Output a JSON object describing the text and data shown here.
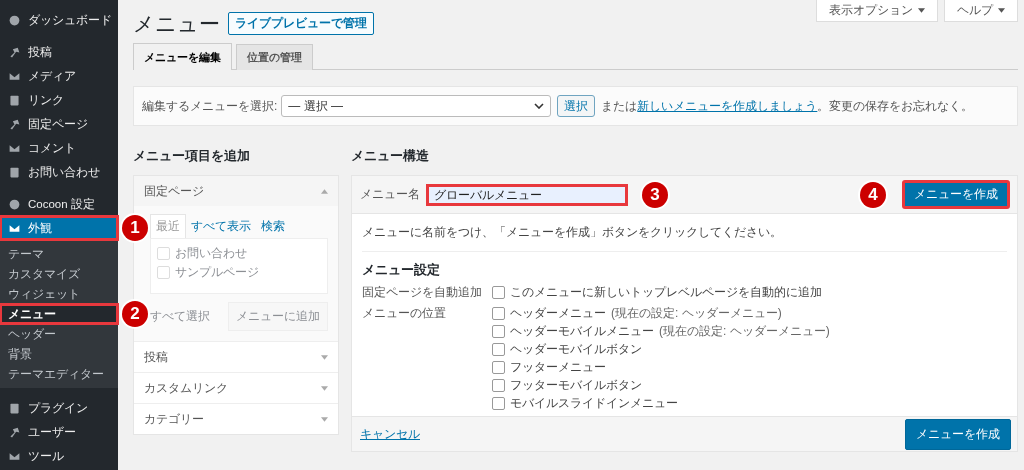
{
  "sidebar": {
    "items": [
      {
        "label": "ダッシュボード",
        "selected": false,
        "highlighted": false
      },
      {
        "label": "投稿",
        "selected": false,
        "highlighted": false
      },
      {
        "label": "メディア",
        "selected": false,
        "highlighted": false
      },
      {
        "label": "リンク",
        "selected": false,
        "highlighted": false
      },
      {
        "label": "固定ページ",
        "selected": false,
        "highlighted": false
      },
      {
        "label": "コメント",
        "selected": false,
        "highlighted": false
      },
      {
        "label": "お問い合わせ",
        "selected": false,
        "highlighted": false
      },
      {
        "label": "Cocoon 設定",
        "selected": false,
        "highlighted": false
      },
      {
        "label": "外観",
        "selected": true,
        "highlighted": true,
        "marker": "1",
        "children": [
          {
            "label": "テーマ",
            "selected": false,
            "highlighted": false
          },
          {
            "label": "カスタマイズ",
            "selected": false,
            "highlighted": false
          },
          {
            "label": "ウィジェット",
            "selected": false,
            "highlighted": false
          },
          {
            "label": "メニュー",
            "selected": true,
            "highlighted": true,
            "marker": "2"
          },
          {
            "label": "ヘッダー",
            "selected": false,
            "highlighted": false
          },
          {
            "label": "背景",
            "selected": false,
            "highlighted": false
          },
          {
            "label": "テーマエディター",
            "selected": false,
            "highlighted": false
          }
        ]
      },
      {
        "label": "プラグイン",
        "selected": false,
        "highlighted": false
      },
      {
        "label": "ユーザー",
        "selected": false,
        "highlighted": false
      },
      {
        "label": "ツール",
        "selected": false,
        "highlighted": false
      }
    ]
  },
  "top_buttons": [
    "表示オプション",
    "ヘルプ"
  ],
  "title": "メニュー",
  "live_preview_button": "ライブプレビューで管理",
  "tabs": [
    {
      "label": "メニューを編集",
      "selected": true
    },
    {
      "label": "位置の管理",
      "selected": false
    }
  ],
  "select_bar": {
    "label": "編集するメニューを選択:",
    "value": "— 選択 —",
    "button": "選択",
    "prefix": "または",
    "link": "新しいメニューを作成しましょう",
    "suffix": "。変更の保存をお忘れなく。"
  },
  "add_items": {
    "heading": "メニュー項目を追加",
    "sections": [
      {
        "title": "固定ページ",
        "expanded": true,
        "tabs": [
          {
            "label": "最近",
            "selected": true
          },
          {
            "label": "すべて表示",
            "selected": false
          },
          {
            "label": "検索",
            "selected": false
          }
        ],
        "items": [
          {
            "label": "お問い合わせ",
            "checked": false
          },
          {
            "label": "サンプルページ",
            "checked": false
          }
        ],
        "select_all": "すべて選択",
        "add_button": "メニューに追加"
      },
      {
        "title": "投稿",
        "expanded": false
      },
      {
        "title": "カスタムリンク",
        "expanded": false
      },
      {
        "title": "カテゴリー",
        "expanded": false
      }
    ]
  },
  "structure": {
    "heading": "メニュー構造",
    "name_label": "メニュー名",
    "name_value": "グローバルメニュー",
    "name_marker": "3",
    "create_button": "メニューを作成",
    "create_marker": "4",
    "instructions": "メニューに名前をつけ、「メニューを作成」ボタンをクリックしてください。",
    "settings_heading": "メニュー設定",
    "settings": [
      {
        "label": "固定ページを自動追加",
        "options": [
          {
            "label": "このメニューに新しいトップレベルページを自動的に追加",
            "checked": false
          }
        ]
      },
      {
        "label": "メニューの位置",
        "options": [
          {
            "label": "ヘッダーメニュー",
            "note": "(現在の設定: ヘッダーメニュー)",
            "checked": false
          },
          {
            "label": "ヘッダーモバイルメニュー",
            "note": "(現在の設定: ヘッダーメニュー)",
            "checked": false
          },
          {
            "label": "ヘッダーモバイルボタン",
            "checked": false
          },
          {
            "label": "フッターメニュー",
            "checked": false
          },
          {
            "label": "フッターモバイルボタン",
            "checked": false
          },
          {
            "label": "モバイルスライドインメニュー",
            "checked": false
          }
        ]
      }
    ],
    "cancel": "キャンセル",
    "footer_button": "メニューを作成"
  }
}
